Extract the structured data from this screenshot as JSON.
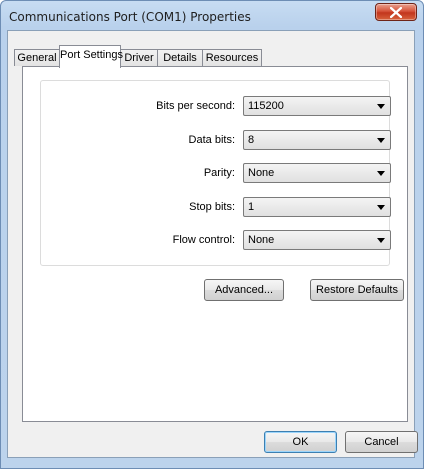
{
  "window": {
    "title": "Communications Port (COM1) Properties"
  },
  "tabs": [
    {
      "label": "General",
      "active": false
    },
    {
      "label": "Port Settings",
      "active": true
    },
    {
      "label": "Driver",
      "active": false
    },
    {
      "label": "Details",
      "active": false
    },
    {
      "label": "Resources",
      "active": false
    }
  ],
  "settings": {
    "bits_per_second": {
      "label": "Bits per second:",
      "value": "115200"
    },
    "data_bits": {
      "label": "Data bits:",
      "value": "8"
    },
    "parity": {
      "label": "Parity:",
      "value": "None"
    },
    "stop_bits": {
      "label": "Stop bits:",
      "value": "1"
    },
    "flow_control": {
      "label": "Flow control:",
      "value": "None"
    }
  },
  "buttons": {
    "advanced": "Advanced...",
    "restore_defaults": "Restore Defaults",
    "ok": "OK",
    "cancel": "Cancel"
  },
  "colors": {
    "accent": "#c2361d",
    "frame": "#b9d1ec"
  }
}
